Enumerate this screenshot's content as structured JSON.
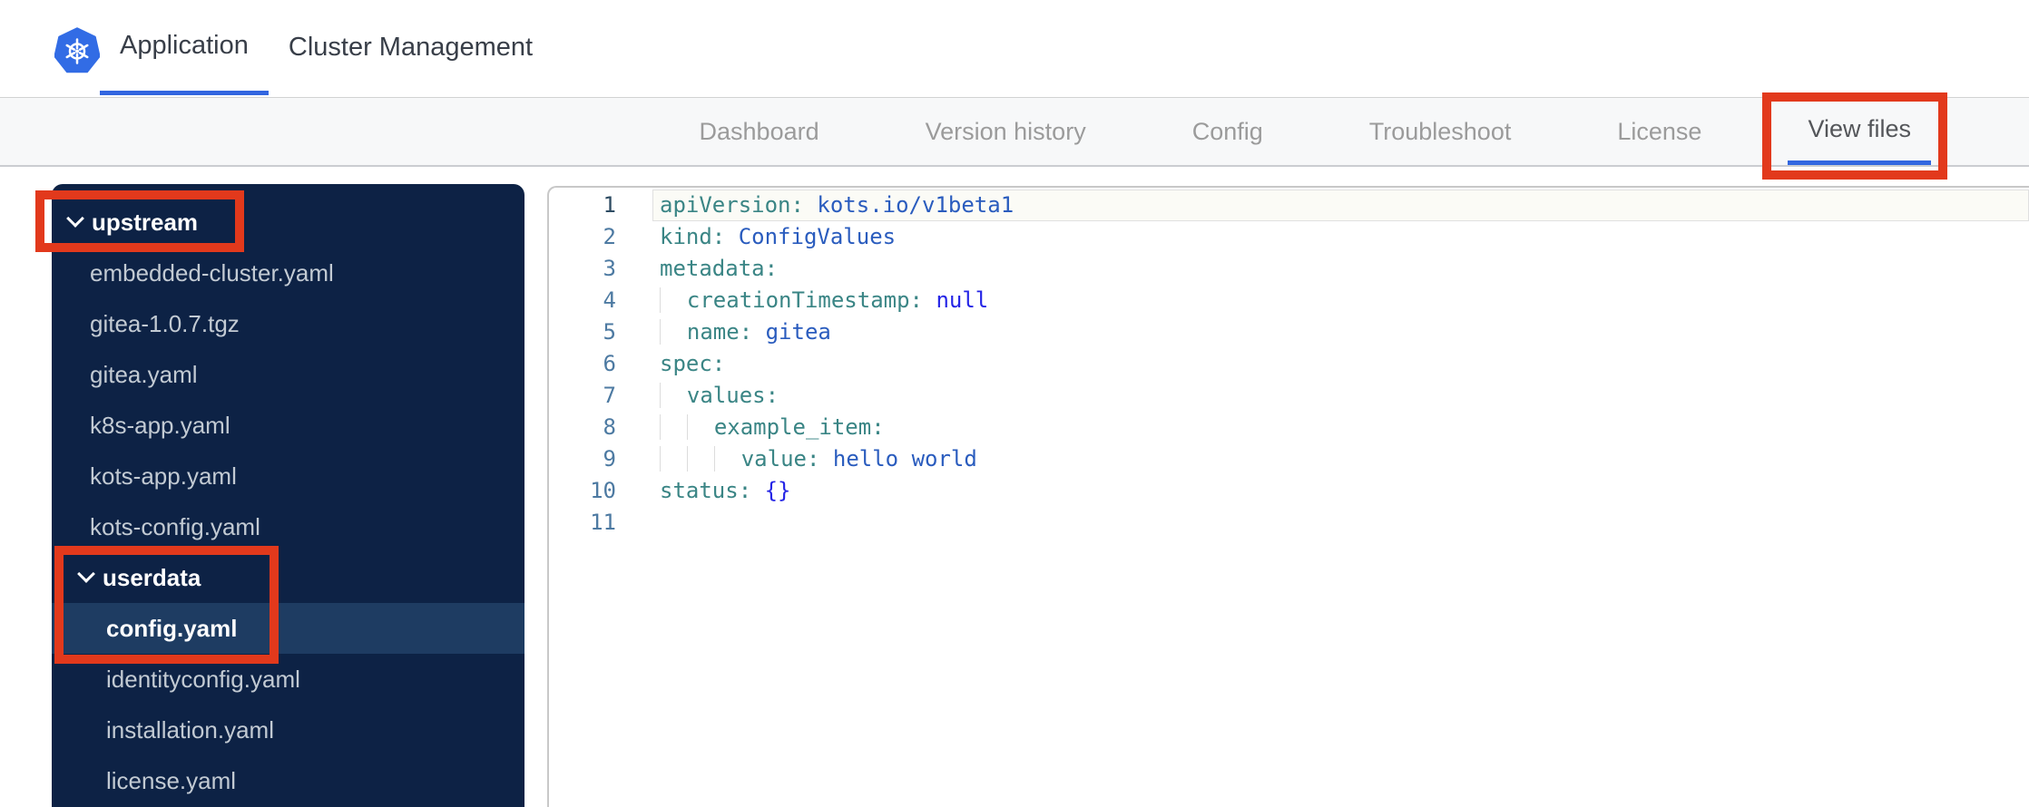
{
  "header": {
    "logo_icon": "kubernetes-helm-logo",
    "tabs": [
      {
        "label": "Application",
        "active": true
      },
      {
        "label": "Cluster Management",
        "active": false
      }
    ]
  },
  "subnav": {
    "items": [
      {
        "label": "Dashboard",
        "active": false
      },
      {
        "label": "Version history",
        "active": false
      },
      {
        "label": "Config",
        "active": false
      },
      {
        "label": "Troubleshoot",
        "active": false
      },
      {
        "label": "License",
        "active": false
      },
      {
        "label": "View files",
        "active": true,
        "annotated": true
      }
    ]
  },
  "file_tree": {
    "items": [
      {
        "label": "upstream",
        "type": "folder",
        "level": 0,
        "expanded": true,
        "annotated": true
      },
      {
        "label": "embedded-cluster.yaml",
        "type": "file",
        "level": 1
      },
      {
        "label": "gitea-1.0.7.tgz",
        "type": "file",
        "level": 1
      },
      {
        "label": "gitea.yaml",
        "type": "file",
        "level": 1
      },
      {
        "label": "k8s-app.yaml",
        "type": "file",
        "level": 1
      },
      {
        "label": "kots-app.yaml",
        "type": "file",
        "level": 1
      },
      {
        "label": "kots-config.yaml",
        "type": "file",
        "level": 1
      },
      {
        "label": "userdata",
        "type": "folder",
        "level": 1,
        "expanded": true,
        "annotated": true
      },
      {
        "label": "config.yaml",
        "type": "file",
        "level": 2,
        "selected": true,
        "annotated": true
      },
      {
        "label": "identityconfig.yaml",
        "type": "file",
        "level": 2
      },
      {
        "label": "installation.yaml",
        "type": "file",
        "level": 2
      },
      {
        "label": "license.yaml",
        "type": "file",
        "level": 2
      }
    ]
  },
  "editor": {
    "language": "yaml",
    "lines": [
      {
        "num": 1,
        "active": true,
        "indent": 0,
        "tokens": [
          {
            "c": "key",
            "t": "apiVersion:"
          },
          {
            "c": "plain",
            "t": " "
          },
          {
            "c": "val",
            "t": "kots.io/v1beta1"
          }
        ]
      },
      {
        "num": 2,
        "indent": 0,
        "tokens": [
          {
            "c": "key",
            "t": "kind:"
          },
          {
            "c": "plain",
            "t": " "
          },
          {
            "c": "val",
            "t": "ConfigValues"
          }
        ]
      },
      {
        "num": 3,
        "indent": 0,
        "tokens": [
          {
            "c": "key",
            "t": "metadata:"
          }
        ]
      },
      {
        "num": 4,
        "indent": 2,
        "tokens": [
          {
            "c": "key",
            "t": "creationTimestamp:"
          },
          {
            "c": "plain",
            "t": " "
          },
          {
            "c": "const",
            "t": "null"
          }
        ]
      },
      {
        "num": 5,
        "indent": 2,
        "tokens": [
          {
            "c": "key",
            "t": "name:"
          },
          {
            "c": "plain",
            "t": " "
          },
          {
            "c": "val",
            "t": "gitea"
          }
        ]
      },
      {
        "num": 6,
        "indent": 0,
        "tokens": [
          {
            "c": "key",
            "t": "spec:"
          }
        ]
      },
      {
        "num": 7,
        "indent": 2,
        "tokens": [
          {
            "c": "key",
            "t": "values:"
          }
        ]
      },
      {
        "num": 8,
        "indent": 4,
        "tokens": [
          {
            "c": "key",
            "t": "example_item:"
          }
        ]
      },
      {
        "num": 9,
        "indent": 6,
        "tokens": [
          {
            "c": "key",
            "t": "value:"
          },
          {
            "c": "plain",
            "t": " "
          },
          {
            "c": "val",
            "t": "hello world"
          }
        ]
      },
      {
        "num": 10,
        "indent": 0,
        "tokens": [
          {
            "c": "key",
            "t": "status:"
          },
          {
            "c": "plain",
            "t": " "
          },
          {
            "c": "const",
            "t": "{}"
          }
        ]
      },
      {
        "num": 11,
        "indent": 0,
        "tokens": []
      }
    ]
  },
  "annotations": {
    "color": "#e2391c",
    "boxes": [
      "view-files-tab",
      "upstream-folder",
      "userdata-and-config-yaml"
    ]
  },
  "colors": {
    "accent_blue": "#3266e0",
    "kubernetes_blue": "#326ce5",
    "sidebar_bg": "#0d2245",
    "sidebar_selected_bg": "#1e3c62",
    "sidebar_file_text": "#c2cad3",
    "subnav_bg": "#f7f8f9",
    "code_key": "#3a8585",
    "code_value": "#2a5cbe",
    "code_constant": "#2525e6",
    "gutter_number": "#4d7aa2",
    "annotation_red": "#e2391c"
  }
}
